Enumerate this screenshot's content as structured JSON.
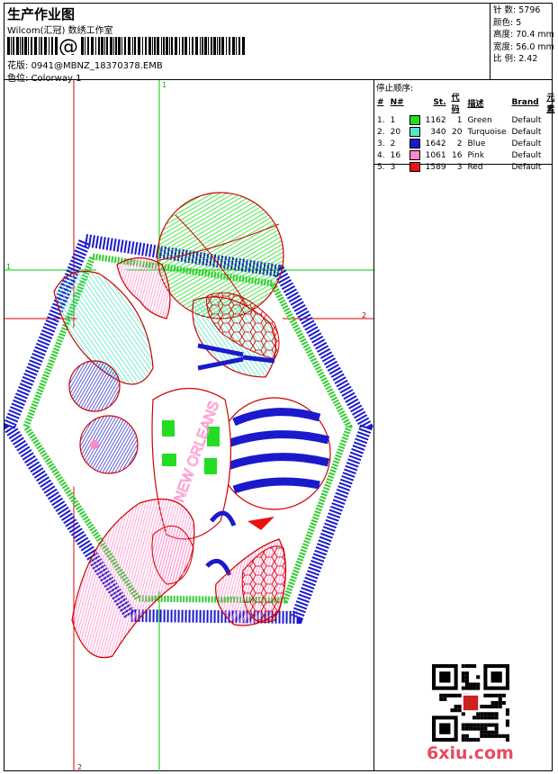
{
  "header": {
    "title": "生产作业图",
    "company": "Wilcom(汇冠) 数绣工作室",
    "file_label": "花版:",
    "file_name": "0941@MBNZ_18370378.EMB",
    "colorway_label": "色位:",
    "colorway": "Colorway 1",
    "at_symbol": "@"
  },
  "stats": {
    "stitches": "针 数: 5796",
    "colors": "颜色: 5",
    "height": "高度: 70.4 mm",
    "width": "宽度: 56.0 mm",
    "scale": "比 例: 2.42"
  },
  "stop_sequence": {
    "title": "停止顺序:",
    "headers": [
      "#",
      "N#",
      "St.",
      "代码",
      "描述",
      "Brand",
      "元素"
    ],
    "rows": [
      {
        "idx": "1.",
        "n": "1",
        "st": "1162",
        "code": "1",
        "desc": "Green",
        "brand": "Default",
        "color": "#22dd22"
      },
      {
        "idx": "2.",
        "n": "20",
        "st": "340",
        "code": "20",
        "desc": "Turquoise",
        "brand": "Default",
        "color": "#55e8c8"
      },
      {
        "idx": "3.",
        "n": "2",
        "st": "1642",
        "code": "2",
        "desc": "Blue",
        "brand": "Default",
        "color": "#1a1acc"
      },
      {
        "idx": "4.",
        "n": "16",
        "st": "1061",
        "code": "16",
        "desc": "Pink",
        "brand": "Default",
        "color": "#ff88c8"
      },
      {
        "idx": "5.",
        "n": "3",
        "st": "1589",
        "code": "3",
        "desc": "Red",
        "brand": "Default",
        "color": "#ee1111"
      }
    ]
  },
  "design": {
    "text": "NEW ORLEANS",
    "guide_labels": {
      "top": "1",
      "left": "1",
      "right": "2",
      "bottom": "2"
    }
  },
  "watermark": {
    "logo": "6xiu.com"
  },
  "colors": {
    "guide_red": "#dd0000",
    "guide_green": "#00cc00",
    "outline": "#d00000"
  }
}
